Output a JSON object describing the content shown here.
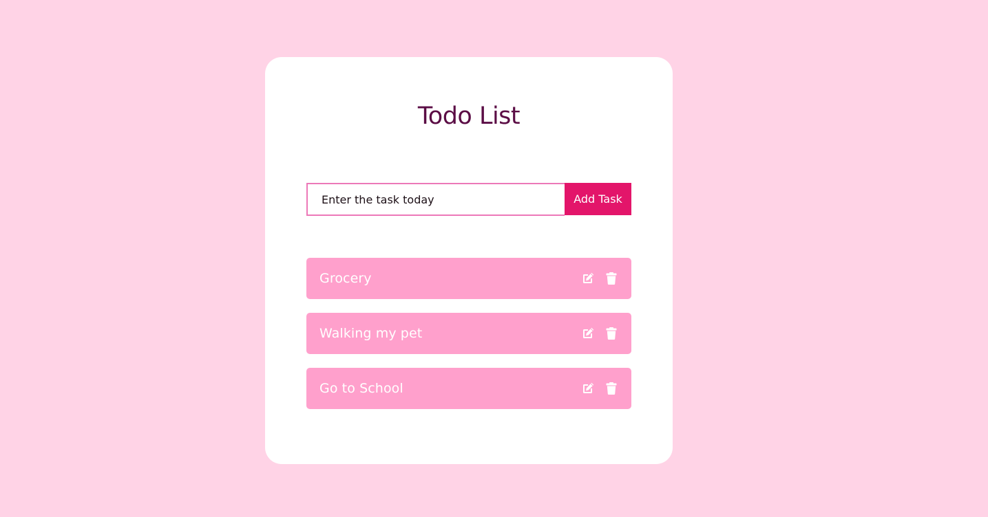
{
  "app": {
    "title": "Todo List"
  },
  "form": {
    "input_placeholder": "Enter the task today",
    "input_value": "",
    "add_button_label": "Add Task"
  },
  "tasks": [
    {
      "text": "Grocery",
      "edit_icon": "edit-icon",
      "delete_icon": "trash-icon"
    },
    {
      "text": "Walking my pet",
      "edit_icon": "edit-icon",
      "delete_icon": "trash-icon"
    },
    {
      "text": "Go to School",
      "edit_icon": "edit-icon",
      "delete_icon": "trash-icon"
    }
  ],
  "colors": {
    "background": "#ffd3e6",
    "card": "#ffffff",
    "title": "#5b0d45",
    "accent": "#e3156a",
    "input_border": "#ec78b8",
    "task_bg": "#ffa0cc",
    "task_text": "#ffffff"
  }
}
